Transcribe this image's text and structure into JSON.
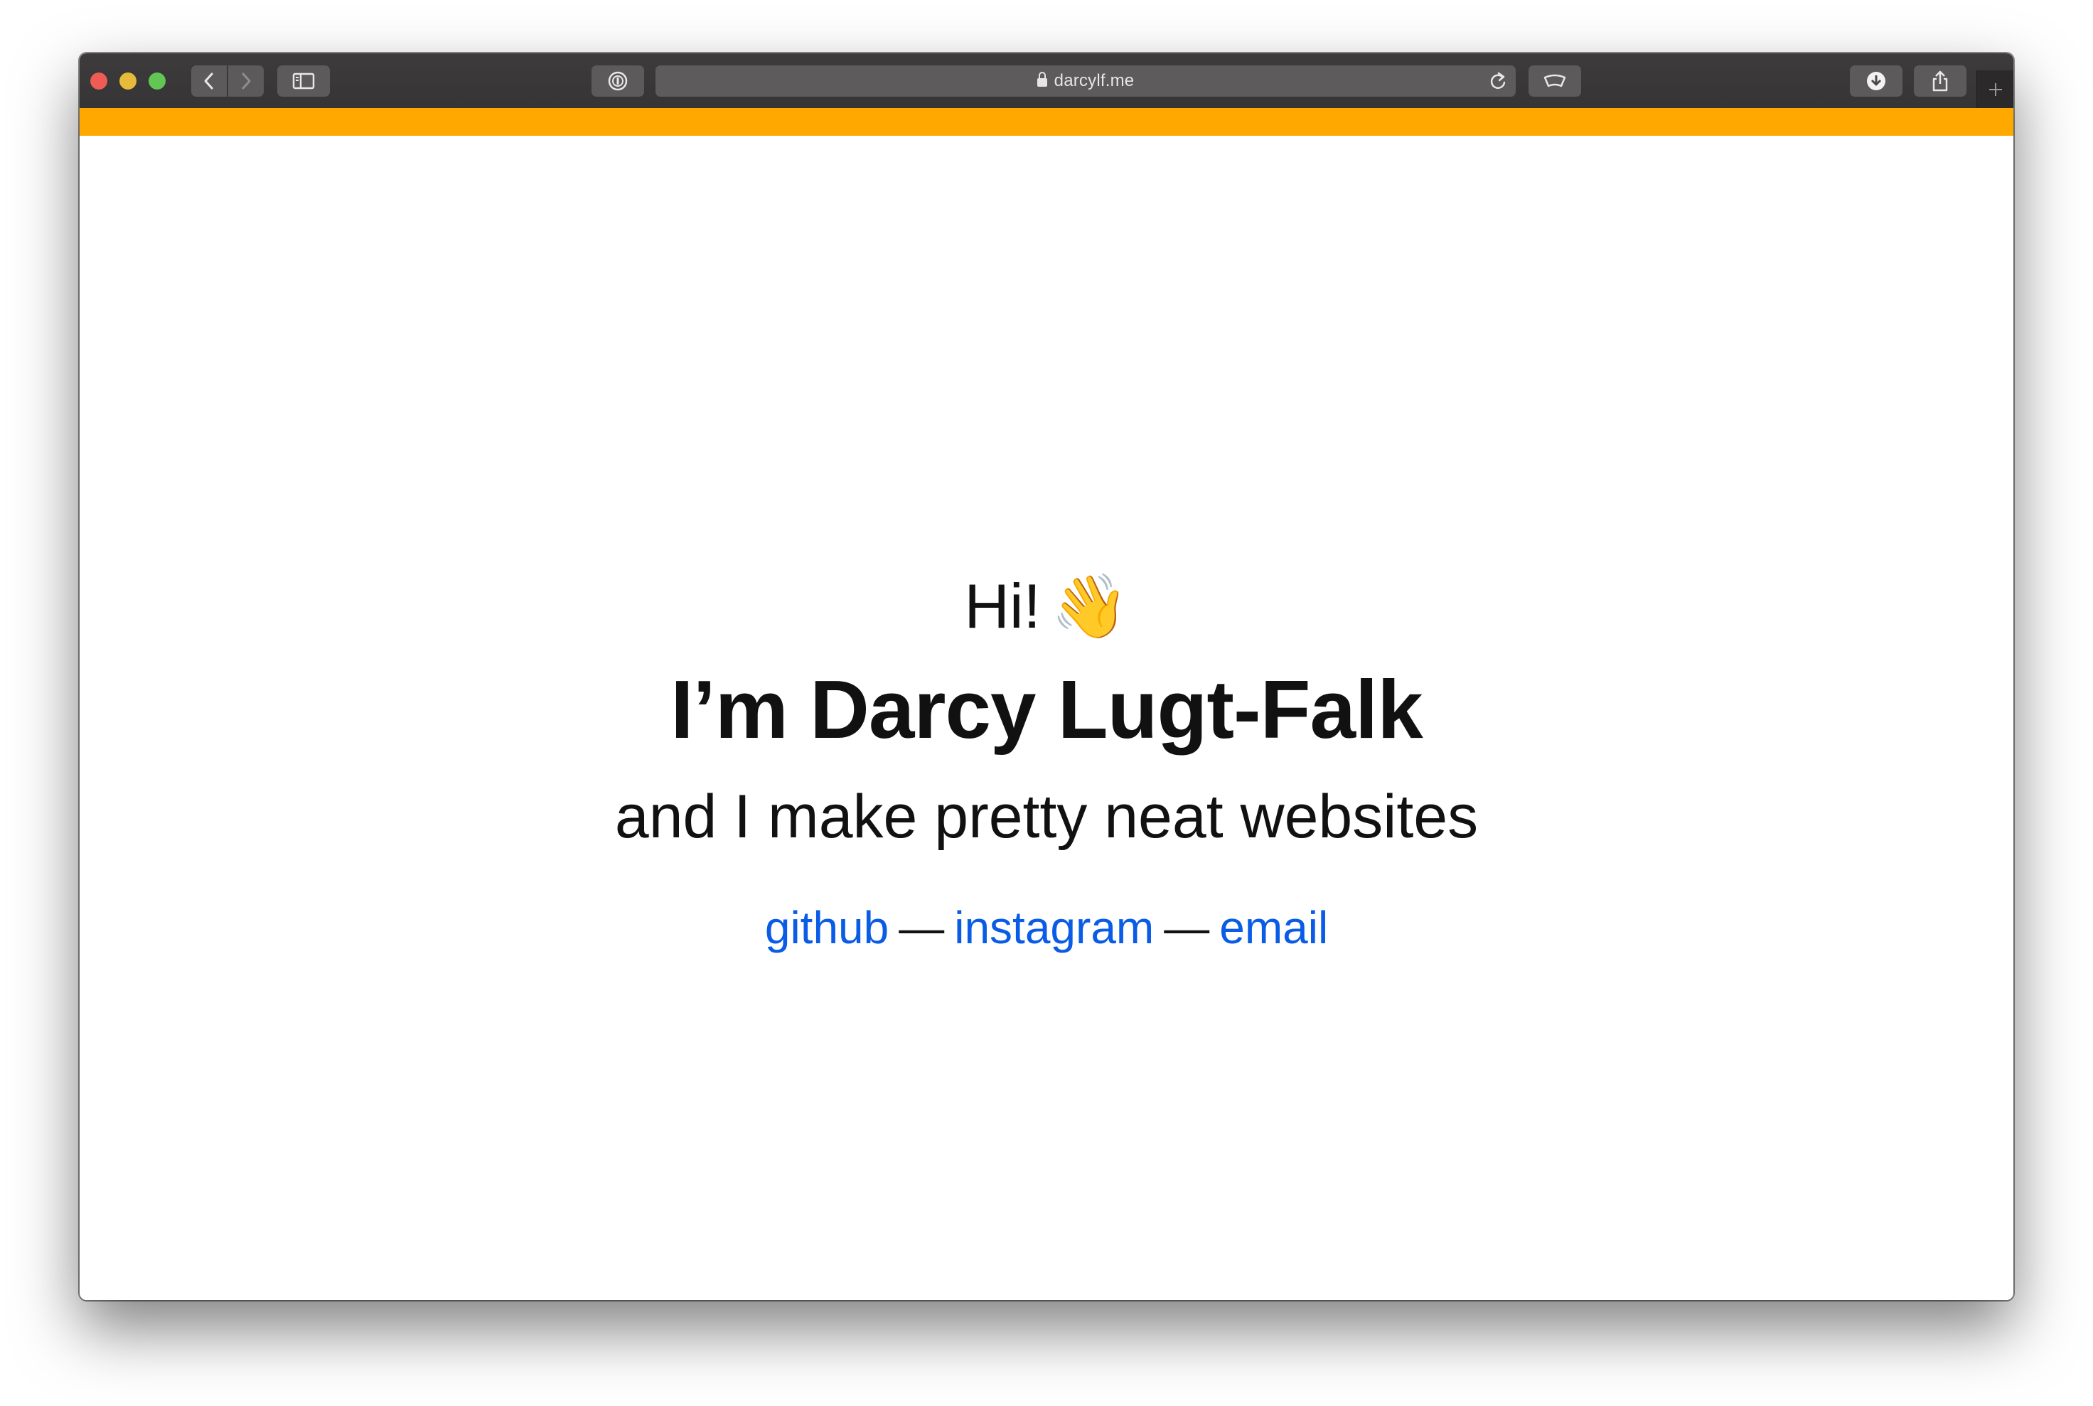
{
  "browser": {
    "url": "darcylf.me",
    "window_controls": {
      "close_color": "#ee5c55",
      "minimize_color": "#e6bb3a",
      "zoom_color": "#62c554"
    },
    "toolbar_icons": {
      "back": "chevron-left-icon",
      "forward": "chevron-right-icon",
      "sidebar": "sidebar-icon",
      "password": "password-manager-icon",
      "reload": "reload-icon",
      "reader": "reader-icon",
      "downloads": "download-icon",
      "share": "share-icon",
      "new_tab": "plus-icon"
    }
  },
  "page": {
    "accent_color": "#ffa800",
    "link_color": "#0a5ce6",
    "greeting": "Hi!",
    "greeting_emoji": "👋",
    "name": "I’m Darcy Lugt-Falk",
    "tagline": "and I make pretty neat websites",
    "links": [
      {
        "label": "github"
      },
      {
        "label": "instagram"
      },
      {
        "label": "email"
      }
    ],
    "separator": "—"
  }
}
